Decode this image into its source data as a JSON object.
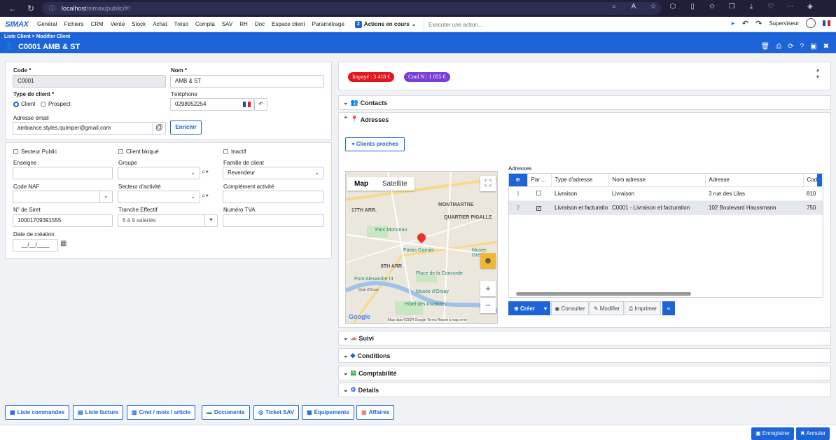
{
  "browser": {
    "url_main": "localhost",
    "url_path": "/simax/public/#!"
  },
  "menu": {
    "logo": "SIMAX",
    "items": [
      "Général",
      "Fichiers",
      "CRM",
      "Vente",
      "Stock",
      "Achat",
      "Tréso",
      "Compta",
      "SAV",
      "RH",
      "Doc",
      "Espace client",
      "Paramétrage"
    ],
    "actions_count": "2",
    "actions_label": "Actions en cours",
    "exec_placeholder": "Executer une action...",
    "user": "Superviseur"
  },
  "header": {
    "breadcrumb": "Liste Client  >  Modifier Client",
    "title": "C0001 AMB & ST"
  },
  "identity": {
    "code_label": "Code *",
    "code_value": "C0001",
    "nom_label": "Nom *",
    "nom_value": "AMB & ST",
    "type_label": "Type de client *",
    "type_client": "Client",
    "type_prospect": "Prospect",
    "tel_label": "Téléphone",
    "tel_value": "0298952254",
    "email_label": "Adresse email",
    "email_value": "ambiance.styles.quimper@gmail.com",
    "enrichir": "Enrichir"
  },
  "details": {
    "secteur_public": "Secteur Public",
    "client_bloque": "Client bloqué",
    "inactif": "Inactif",
    "enseigne_label": "Enseigne",
    "groupe_label": "Groupe",
    "famille_label": "Famille de client",
    "famille_value": "Revendeur",
    "naf_label": "Code NAF",
    "secteur_label": "Secteur d'activité",
    "complement_label": "Complément activité",
    "siret_label": "N° de Siret",
    "siret_value": "10001709391555",
    "tranche_label": "Tranche Effectif",
    "tranche_value": "6 à 9 salariés",
    "tva_label": "Numéro TVA",
    "date_label": "Date de création",
    "date_value": "__/__/____"
  },
  "badges": {
    "impaye": "Impayé : 3 418 €",
    "cmd": "Cmd N : 1 055 €",
    "impaye_color": "#e3161d",
    "cmd_color": "#7a3fd6"
  },
  "sections": {
    "contacts": "Contacts",
    "adresses": "Adresses",
    "suivi": "Suivi",
    "conditions": "Conditions",
    "comptabilite": "Comptabilité",
    "details": "Détails"
  },
  "adresses": {
    "clients_proches": "Clients proches",
    "grid_title": "Adresses",
    "columns": [
      "Par ...",
      "Type d'adresse",
      "Nom adresse",
      "Adresse",
      "Cod"
    ],
    "rows": [
      {
        "n": "1",
        "checked": false,
        "type": "Livraison",
        "nom": "Livraison",
        "adresse": "3 rue des Lilas",
        "code": "810"
      },
      {
        "n": "2",
        "checked": true,
        "type": "Livraison et facturatio",
        "nom": "C0001 - Livraison et facturation",
        "adresse": "102 Boulevard Haussmann",
        "code": "750"
      }
    ],
    "buttons": {
      "creer": "Créer",
      "consulter": "Consulter",
      "modifier": "Modifier",
      "imprimer": "Imprimer"
    }
  },
  "map": {
    "tab_map": "Map",
    "tab_satellite": "Satellite",
    "labels": [
      "17TH ARR.",
      "MONTMARTRE",
      "QUARTIER PIGALLE",
      "Parc Monceau",
      "Palais Garnier",
      "Musée Grévin",
      "8TH ARR",
      "Place de la Concorde",
      "Pont Alexandre III",
      "Musée d'Orsay",
      "Hôtel des Invalides",
      "Quai d'Orsay"
    ],
    "footer": "Map data ©2024 Google   Terms   Report a map error"
  },
  "bottom": [
    "Liste commandes",
    "Liste facture",
    "Cmd / mois / article",
    "Documents",
    "Ticket SAV",
    "Équipements",
    "Affaires"
  ],
  "footer": {
    "enregistrer": "Enregistrer",
    "annuler": "Annuler"
  }
}
